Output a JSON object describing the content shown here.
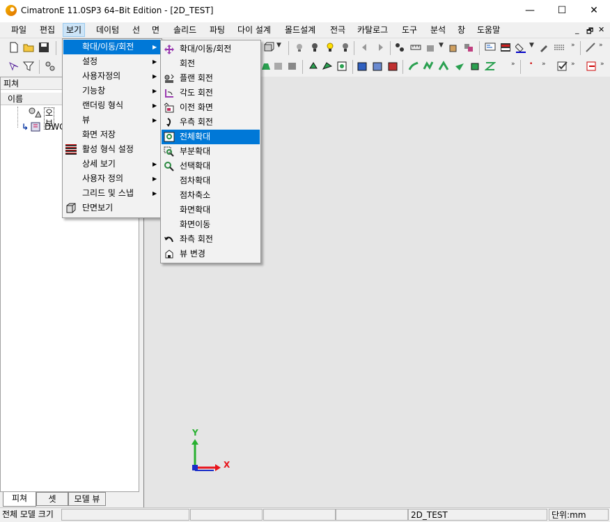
{
  "window": {
    "title": "CimatronE 11.0SP3 64–Bit Edition - [2D_TEST]",
    "minimize_glyph": "—",
    "maximize_glyph": "☐",
    "close_glyph": "✕"
  },
  "menubar": {
    "items": [
      "파일",
      "편집",
      "보기",
      "데이텀",
      "선",
      "면",
      "솔리드",
      "파팅",
      "다이 설계",
      "몰드설계",
      "전극",
      "카탈로그",
      "도구",
      "분석",
      "창",
      "도움말"
    ],
    "active_index": 2,
    "mdi_controls": [
      "_",
      "🗗",
      "✕"
    ]
  },
  "left_panel": {
    "title": "피쳐",
    "column_header": "이름",
    "tree": [
      {
        "label": "오브",
        "icon": "objects-icon"
      },
      {
        "label": "DWG",
        "icon": "drawing-icon"
      }
    ],
    "tabs": [
      "피쳐",
      "셋",
      "모델 뷰"
    ],
    "active_tab": 0
  },
  "view_menu": {
    "items": [
      {
        "label": "확대/이동/회전",
        "submenu": true,
        "highlighted": true,
        "icon": ""
      },
      {
        "label": "설정",
        "submenu": true,
        "icon": ""
      },
      {
        "label": "사용자정의",
        "submenu": true,
        "icon": ""
      },
      {
        "label": "기능창",
        "submenu": true,
        "icon": ""
      },
      {
        "label": "랜더링 형식",
        "submenu": true,
        "icon": ""
      },
      {
        "label": "뷰",
        "submenu": true,
        "icon": ""
      },
      {
        "label": "화면 저장",
        "submenu": false,
        "icon": ""
      },
      {
        "label": "활성 형식 설정",
        "submenu": false,
        "icon": "grid-icon"
      },
      {
        "label": "상세 보기",
        "submenu": true,
        "icon": ""
      },
      {
        "label": "사용자 정의",
        "submenu": true,
        "icon": ""
      },
      {
        "label": "그리드 및 스냅",
        "submenu": true,
        "icon": ""
      },
      {
        "label": "단면보기",
        "submenu": false,
        "icon": "section-view-icon"
      }
    ]
  },
  "zoom_submenu": {
    "items": [
      {
        "label": "확대/이동/회전",
        "icon": "zoom-pan-rotate-icon"
      },
      {
        "label": "회전",
        "icon": ""
      },
      {
        "label": "플랜 회전",
        "icon": "plane-rotate-icon"
      },
      {
        "label": "각도 회전",
        "icon": "angle-rotate-icon"
      },
      {
        "label": "이전 화면",
        "icon": "previous-view-icon"
      },
      {
        "label": "우측 회전",
        "icon": "rotate-right-icon"
      },
      {
        "label": "전체확대",
        "icon": "zoom-all-icon",
        "highlighted": true
      },
      {
        "label": "부분확대",
        "icon": "zoom-window-icon"
      },
      {
        "label": "선택확대",
        "icon": "zoom-selected-icon"
      },
      {
        "label": "점차확대",
        "icon": ""
      },
      {
        "label": "점차축소",
        "icon": ""
      },
      {
        "label": "화면확대",
        "icon": ""
      },
      {
        "label": "화면이동",
        "icon": ""
      },
      {
        "label": "좌측 회전",
        "icon": "rotate-left-icon"
      },
      {
        "label": "뷰 변경",
        "icon": "change-view-icon"
      }
    ]
  },
  "axes": {
    "x_label": "X",
    "y_label": "Y",
    "x_color": "#e8141b",
    "y_color": "#28b030"
  },
  "statusbar": {
    "message": "전체 모델 크기",
    "file": "2D_TEST",
    "unit": "단위:mm"
  },
  "colors": {
    "highlight": "#0078d7",
    "menu_active": "#cce4f7"
  }
}
